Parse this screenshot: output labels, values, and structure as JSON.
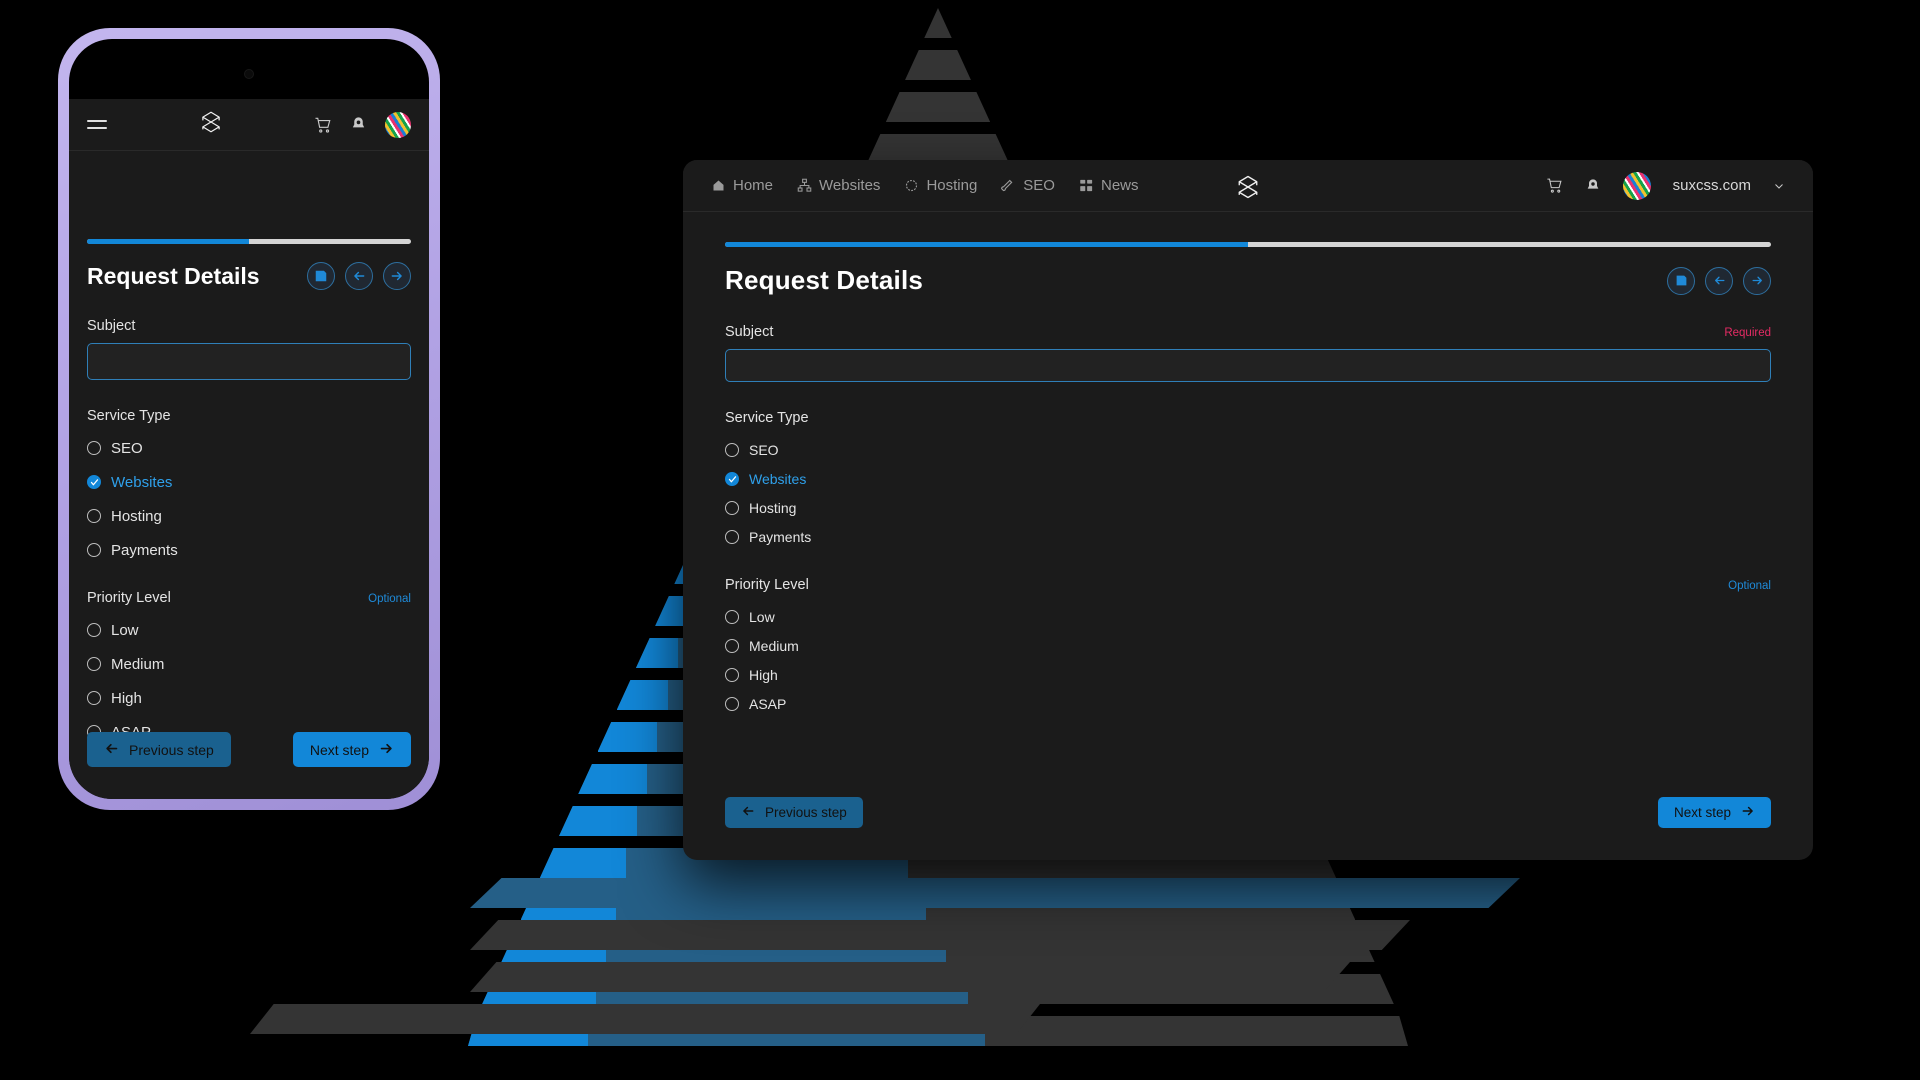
{
  "theme": {
    "accent_blue": "#1287d8",
    "accent_blue_dark": "#1a618f",
    "required_color": "#e52b64",
    "optional_color": "#1f8ad8",
    "panel_bg": "#1b1b1b",
    "page_bg": "#000000",
    "phone_bezel": "#b4a5e6"
  },
  "desktop": {
    "nav": {
      "items": [
        {
          "label": "Home",
          "icon": "home-icon"
        },
        {
          "label": "Websites",
          "icon": "sitemap-icon"
        },
        {
          "label": "Hosting",
          "icon": "cloud-icon"
        },
        {
          "label": "SEO",
          "icon": "brush-icon"
        },
        {
          "label": "News",
          "icon": "grid-icon"
        }
      ],
      "logo_icon": "stacked-layers-logo",
      "cart_icon": "cart-icon",
      "bell_icon": "bell-icon",
      "avatar_icon": "user-avatar",
      "user_label": "suxcss.com",
      "chevron_icon": "chevron-down-icon"
    }
  },
  "phone": {
    "nav": {
      "menu_icon": "hamburger-menu-icon",
      "logo_icon": "stacked-layers-logo",
      "cart_icon": "cart-icon",
      "bell_icon": "bell-icon",
      "avatar_icon": "user-avatar"
    }
  },
  "form": {
    "progress_percent": 50,
    "title": "Request Details",
    "actions": [
      {
        "name": "save-button",
        "icon": "floppy-save-icon"
      },
      {
        "name": "back-button",
        "icon": "arrow-left-icon"
      },
      {
        "name": "forward-button",
        "icon": "arrow-right-icon"
      }
    ],
    "subject": {
      "label": "Subject",
      "flag": "Required",
      "value": "",
      "placeholder": ""
    },
    "service_type": {
      "label": "Service Type",
      "flag": "",
      "options": [
        {
          "label": "SEO",
          "checked": false
        },
        {
          "label": "Websites",
          "checked": true
        },
        {
          "label": "Hosting",
          "checked": false
        },
        {
          "label": "Payments",
          "checked": false
        }
      ]
    },
    "priority_level": {
      "label": "Priority Level",
      "flag": "Optional",
      "options": [
        {
          "label": "Low",
          "checked": false
        },
        {
          "label": "Medium",
          "checked": false
        },
        {
          "label": "High",
          "checked": false
        },
        {
          "label": "ASAP",
          "checked": false
        }
      ]
    },
    "prev_button": {
      "label": "Previous step",
      "icon": "arrow-left-icon"
    },
    "next_button": {
      "label": "Next step",
      "icon": "arrow-right-icon"
    }
  },
  "background": {
    "shape": "striped-pyramid",
    "stripe_colors": [
      "#343434",
      "#1287d8",
      "#255f87"
    ],
    "stripe_count": 22
  }
}
